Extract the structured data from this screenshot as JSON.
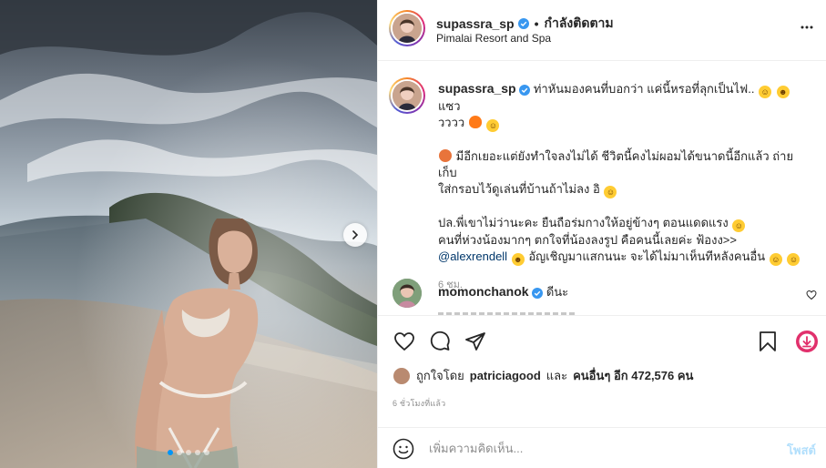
{
  "header": {
    "username": "supassra_sp",
    "bullet": "•",
    "follow_status": "กำลังติดตาม",
    "location": "Pimalai Resort and Spa"
  },
  "caption": {
    "username": "supassra_sp",
    "line1": "ท่าหันมองคนที่บอกว่า แค่นี้หรอที่ลุกเป็นไฟ..",
    "line1_tail": "แซว",
    "line2": "วววว",
    "para2_a": "มีอีกเยอะแต่ยังทำใจลงไม่ได้ ชีวิตนี้คงไม่ผอมได้ขนาดนี้อีกแล้ว ถ่ายเก็บ",
    "para2_b": "ใส่กรอบไว้ดูเล่นที่บ้านถ้าไม่ลง อิ",
    "para3_a": "ปล.พี่เขาไม่ว่านะคะ ยืนถือร่มกางให้อยู่ข้างๆ ตอนแดดแรง",
    "para3_b": "คนที่ห่วงน้องมากๆ ตกใจที่น้องลงรูป คือคนนี้เลยค่ะ ฟ้องง>>",
    "mention": "@alexrendell",
    "para3_c": "อัญเชิญมาแสกนนะ จะได้ไม่มาเห็นทีหลังคนอื่น",
    "time": "6 ชม."
  },
  "comment": {
    "username": "momonchanok",
    "text": "ดีนะ"
  },
  "likes": {
    "prefix": "ถูกใจโดย",
    "user": "patriciagood",
    "and": "และ",
    "others": "คนอื่นๆ อีก 472,576 คน"
  },
  "posted_time": "6 ชั่วโมงที่แล้ว",
  "composer": {
    "placeholder": "เพิ่มความคิดเห็น...",
    "post_label": "โพสต์"
  },
  "carousel": {
    "total": 5,
    "active_index": 0
  },
  "colors": {
    "verified": "#3897f0",
    "link": "#00376b",
    "post_disabled": "#b2dffc",
    "download_accent": "#e1306c"
  },
  "icons": {
    "more": "more-horizontal-icon",
    "like": "heart-icon",
    "comment": "comment-icon",
    "share": "share-icon",
    "save": "bookmark-icon",
    "download": "download-icon",
    "emoji": "smiley-icon",
    "next": "chevron-right-icon"
  }
}
